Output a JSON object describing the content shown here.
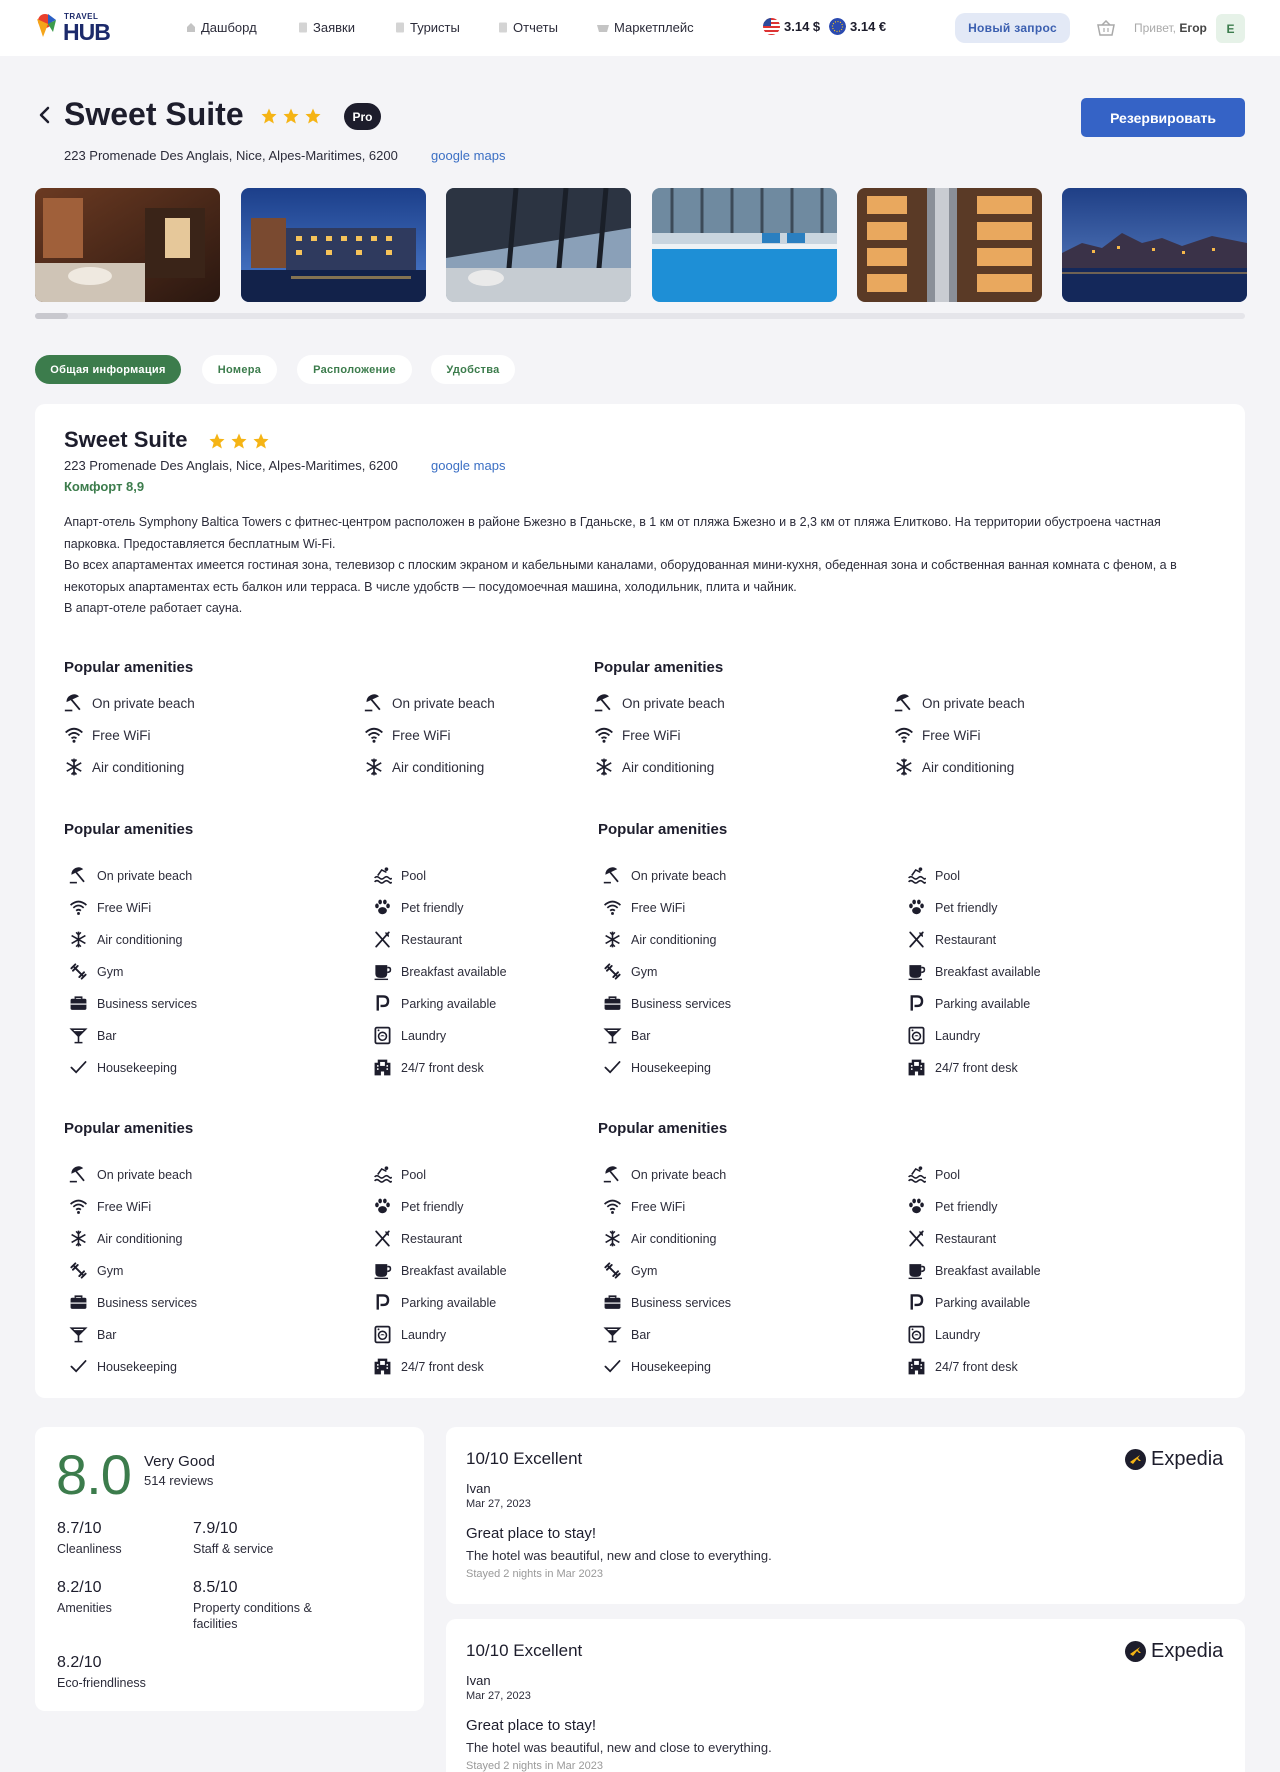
{
  "header": {
    "logo_small": "TRAVEL",
    "logo_big": "HUB",
    "nav": [
      {
        "label": "Дашборд",
        "icon": "home-icon"
      },
      {
        "label": "Заявки",
        "icon": "document-icon"
      },
      {
        "label": "Туристы",
        "icon": "document-icon"
      },
      {
        "label": "Отчеты",
        "icon": "document-icon"
      },
      {
        "label": "Маркетплейс",
        "icon": "basket-icon"
      }
    ],
    "usd_rate": "3.14 $",
    "eur_rate": "3.14 €",
    "new_request": "Новый запрос",
    "greeting_prefix": "Привет,",
    "user_name": "Егор",
    "avatar_letter": "Е"
  },
  "hotel": {
    "name": "Sweet Suite",
    "stars": 3,
    "badge": "Pro",
    "address": "223 Promenade Des Anglais, Nice, Alpes-Maritimes, 6200",
    "map_link": "google maps",
    "reserve_button": "Резервировать",
    "comfort": "Комфорт 8,9",
    "description": [
      "Апарт-отель Symphony Baltica Towers с фитнес-центром расположен в районе Бжезно в Гданьске, в 1 км от пляжа Бжезно и в 2,3 км от пляжа Елитково. На территории обустроена частная парковка. Предоставляется бесплатным Wi-Fi.",
      "Во всех апартаментах имеется гостиная зона, телевизор с плоским экраном и кабельными каналами, оборудованная мини-кухня, обеденная зона и собственная ванная комната с феном, а в некоторых апартаментах есть балкон или терраса. В числе удобств — посудомоечная машина, холодильник, плита и чайник.",
      "В апарт-отеле работает сауна."
    ]
  },
  "tabs": [
    "Общая информация",
    "Номера",
    "Расположение",
    "Удобства"
  ],
  "amenities": {
    "heading": "Popular amenities",
    "short": [
      {
        "label": "On private beach",
        "icon": "beach-umbrella-icon"
      },
      {
        "label": "Free WiFi",
        "icon": "wifi-icon"
      },
      {
        "label": "Air conditioning",
        "icon": "snowflake-icon"
      }
    ],
    "left": [
      {
        "label": "On private beach",
        "icon": "beach-umbrella-icon"
      },
      {
        "label": "Free WiFi",
        "icon": "wifi-icon"
      },
      {
        "label": "Air conditioning",
        "icon": "snowflake-icon"
      },
      {
        "label": "Gym",
        "icon": "dumbbell-icon"
      },
      {
        "label": "Business services",
        "icon": "briefcase-icon"
      },
      {
        "label": "Bar",
        "icon": "cocktail-icon"
      },
      {
        "label": "Housekeeping",
        "icon": "check-icon"
      }
    ],
    "right": [
      {
        "label": "Pool",
        "icon": "pool-icon"
      },
      {
        "label": "Pet friendly",
        "icon": "paw-icon"
      },
      {
        "label": "Restaurant",
        "icon": "fork-knife-icon"
      },
      {
        "label": "Breakfast available",
        "icon": "coffee-cup-icon"
      },
      {
        "label": "Parking available",
        "icon": "parking-icon"
      },
      {
        "label": "Laundry",
        "icon": "washing-machine-icon"
      },
      {
        "label": "24/7 front desk",
        "icon": "front-desk-icon"
      }
    ]
  },
  "rating": {
    "score": "8.0",
    "label": "Very Good",
    "reviews": "514 reviews",
    "subscores": [
      {
        "value": "8.7/10",
        "label": "Cleanliness"
      },
      {
        "value": "7.9/10",
        "label": "Staff & service"
      },
      {
        "value": "8.2/10",
        "label": "Amenities"
      },
      {
        "value": "8.5/10",
        "label": "Property conditions & facilities"
      },
      {
        "value": "8.2/10",
        "label": "Eco-friendliness"
      }
    ]
  },
  "reviews": [
    {
      "rating": "10/10 Excellent",
      "source": "Expedia",
      "author": "Ivan",
      "date": "Mar 27, 2023",
      "title": "Great place to stay!",
      "text": "The hotel was beautiful, new and close to everything.",
      "stay": "Stayed 2 nights in Mar 2023"
    },
    {
      "rating": "10/10 Excellent",
      "source": "Expedia",
      "author": "Ivan",
      "date": "Mar 27, 2023",
      "title": "Great place to stay!",
      "text": "The hotel was beautiful, new and close to everything.",
      "stay": "Stayed 2 nights in Mar 2023"
    }
  ],
  "colors": {
    "accent_green": "#3c7c4c",
    "primary_blue": "#3563c6",
    "star": "#f5b415",
    "link": "#3b6fc4"
  }
}
